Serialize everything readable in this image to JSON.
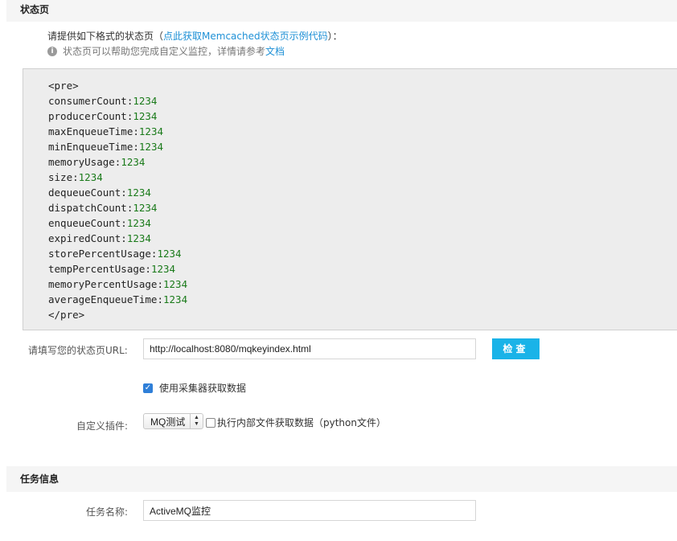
{
  "status_section": {
    "title": "状态页",
    "intro_prefix": "请提供如下格式的状态页（",
    "intro_link": "点此获取Memcached状态页示例代码",
    "intro_suffix": "）：",
    "hint_text": "状态页可以帮助您完成自定义监控，详情请参考",
    "hint_link": "文档",
    "code": {
      "open_tag": "<pre>",
      "lines": [
        {
          "key": "consumerCount:",
          "value": "1234"
        },
        {
          "key": "producerCount:",
          "value": "1234"
        },
        {
          "key": "maxEnqueueTime:",
          "value": "1234"
        },
        {
          "key": "minEnqueueTime:",
          "value": "1234"
        },
        {
          "key": "memoryUsage:",
          "value": "1234"
        },
        {
          "key": "size:",
          "value": "1234"
        },
        {
          "key": "dequeueCount:",
          "value": "1234"
        },
        {
          "key": "dispatchCount:",
          "value": "1234"
        },
        {
          "key": "enqueueCount:",
          "value": "1234"
        },
        {
          "key": "expiredCount:",
          "value": "1234"
        },
        {
          "key": "storePercentUsage:",
          "value": "1234"
        },
        {
          "key": "tempPercentUsage:",
          "value": "1234"
        },
        {
          "key": "memoryPercentUsage:",
          "value": "1234"
        },
        {
          "key": "averageEnqueueTime:",
          "value": "1234"
        }
      ],
      "close_tag": "</pre>"
    },
    "url_label": "请填写您的状态页URL:",
    "url_value": "http://localhost:8080/mqkeyindex.html",
    "check_button": "检查",
    "collector_checkbox_label": "使用采集器获取数据",
    "collector_checked": true,
    "plugin_label": "自定义插件:",
    "plugin_selected": "MQ测试",
    "internal_file_label": "执行内部文件获取数据（python文件）",
    "internal_file_checked": false
  },
  "task_section": {
    "title": "任务信息",
    "name_label": "任务名称:",
    "name_value": "ActiveMQ监控"
  },
  "colors": {
    "accent": "#1ab3e8",
    "link": "#1e90d6",
    "code_value": "#1a7a1a"
  }
}
